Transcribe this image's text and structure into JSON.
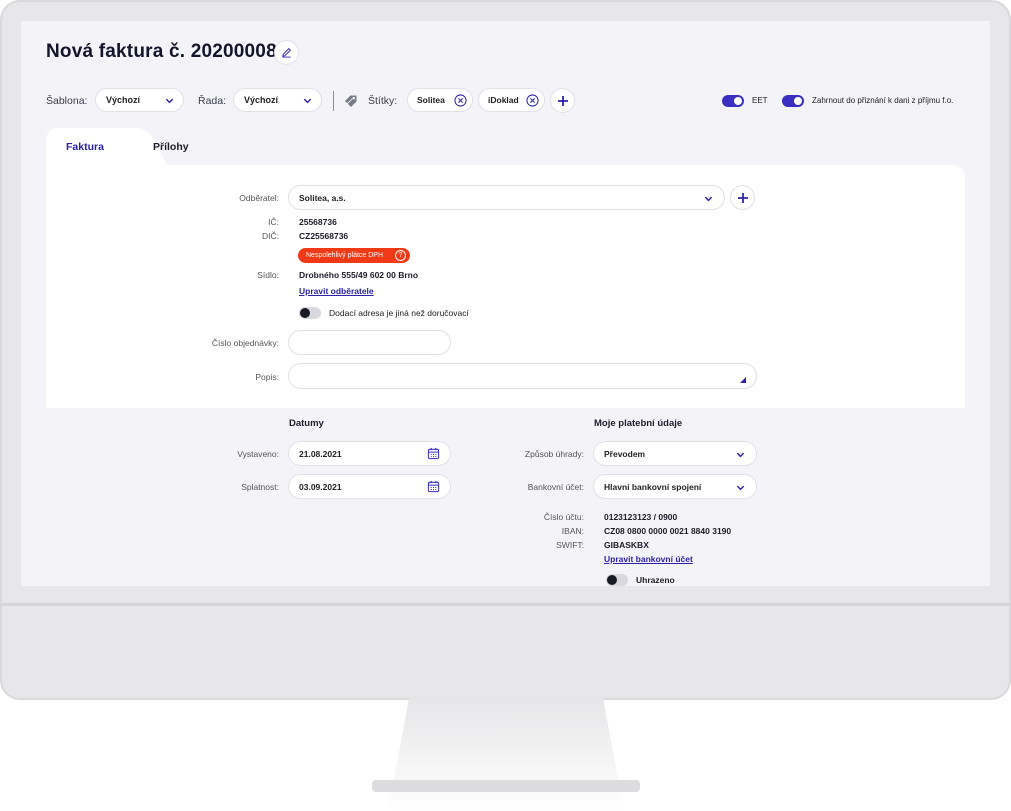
{
  "header": {
    "title": "Nová faktura č. 20200008"
  },
  "toolbar": {
    "template_label": "Šablona:",
    "template_value": "Výchozí",
    "series_label": "Řada:",
    "series_value": "Výchozí",
    "tags_label": "Štítky:",
    "tags": [
      "Solitea",
      "iDoklad"
    ],
    "eet_label": "EET",
    "eet_on": true,
    "tax_label": "Zahrnout do přiznání k dani z příjmu f.o.",
    "tax_on": true
  },
  "tabs": [
    {
      "label": "Faktura",
      "active": true
    },
    {
      "label": "Přílohy",
      "active": false
    }
  ],
  "customer": {
    "label": "Odběratel:",
    "value": "Solitea, a.s.",
    "ic_label": "IČ:",
    "ic": "25568736",
    "dic_label": "DIČ:",
    "dic": "CZ25568736",
    "badge": "Nespolehlivý plátce DPH",
    "badge_icon": "?",
    "address_label": "Sídlo:",
    "address": "Drobného 555/49 602 00 Brno",
    "edit_link": "Upravit odběratele",
    "delivery_toggle_label": "Dodací adresa je jiná než doručovací",
    "delivery_on": false,
    "order_label": "Číslo objednávky:",
    "order_value": "",
    "desc_label": "Popis:",
    "desc_value": ""
  },
  "dates": {
    "heading": "Datumy",
    "issued_label": "Vystaveno:",
    "issued": "21.08.2021",
    "due_label": "Splatnost:",
    "due": "03.09.2021"
  },
  "payment": {
    "heading": "Moje platební údaje",
    "method_label": "Způsob úhrady:",
    "method": "Převodem",
    "bank_label": "Bankovní účet:",
    "bank": "Hlavní bankovní spojení",
    "account_label": "Číslo účtu:",
    "account": "0123123123 / 0900",
    "iban_label": "IBAN:",
    "iban": "CZ08 0800 0000 0021 8840 3190",
    "swift_label": "SWIFT:",
    "swift": "GIBASKBX",
    "edit_link": "Upravit bankovní účet",
    "paid_label": "Uhrazeno",
    "paid_on": false
  },
  "colors": {
    "accent": "#3a2fbf",
    "warning": "#f03a17"
  }
}
